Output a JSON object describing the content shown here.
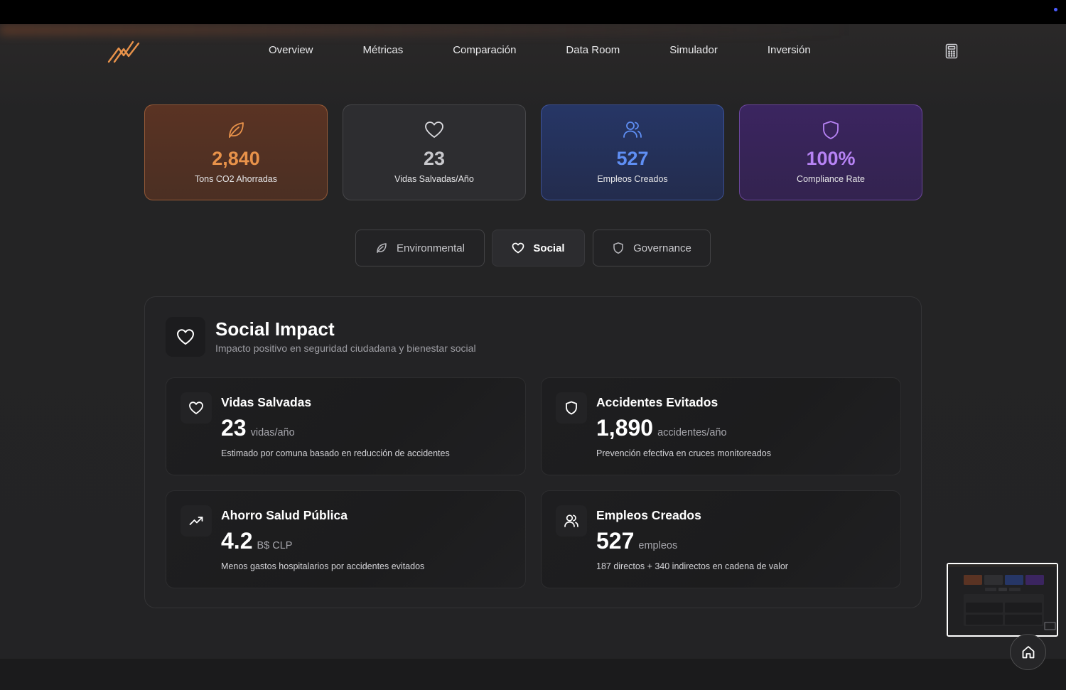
{
  "colors": {
    "orange": "#e8924a",
    "blue": "#5f8ff5",
    "purple": "#b783f5",
    "gray_value": "#c8c8cc"
  },
  "nav": {
    "items": [
      {
        "label": "Overview"
      },
      {
        "label": "Métricas"
      },
      {
        "label": "Comparación"
      },
      {
        "label": "Data Room"
      },
      {
        "label": "Simulador"
      },
      {
        "label": "Inversión"
      }
    ]
  },
  "stats": [
    {
      "icon": "leaf-icon",
      "value": "2,840",
      "label": "Tons CO2 Ahorradas"
    },
    {
      "icon": "heart-icon",
      "value": "23",
      "label": "Vidas Salvadas/Año"
    },
    {
      "icon": "users-icon",
      "value": "527",
      "label": "Empleos Creados"
    },
    {
      "icon": "shield-icon",
      "value": "100%",
      "label": "Compliance Rate"
    }
  ],
  "tabs": [
    {
      "label": "Environmental",
      "icon": "leaf-icon",
      "active": false
    },
    {
      "label": "Social",
      "icon": "heart-icon",
      "active": true
    },
    {
      "label": "Governance",
      "icon": "shield-icon",
      "active": false
    }
  ],
  "panel": {
    "title": "Social Impact",
    "subtitle": "Impacto positivo en seguridad ciudadana y bienestar social",
    "metrics": [
      {
        "icon": "heart-icon",
        "title": "Vidas Salvadas",
        "value": "23",
        "unit": "vidas/año",
        "description": "Estimado por comuna basado en reducción de accidentes"
      },
      {
        "icon": "shield-icon",
        "title": "Accidentes Evitados",
        "value": "1,890",
        "unit": "accidentes/año",
        "description": "Prevención efectiva en cruces monitoreados"
      },
      {
        "icon": "trending-up-icon",
        "title": "Ahorro Salud Pública",
        "value": "4.2",
        "unit": "B$ CLP",
        "description": "Menos gastos hospitalarios por accidentes evitados"
      },
      {
        "icon": "users-icon",
        "title": "Empleos Creados",
        "value": "527",
        "unit": "empleos",
        "description": "187 directos + 340 indirectos en cadena de valor"
      }
    ]
  }
}
